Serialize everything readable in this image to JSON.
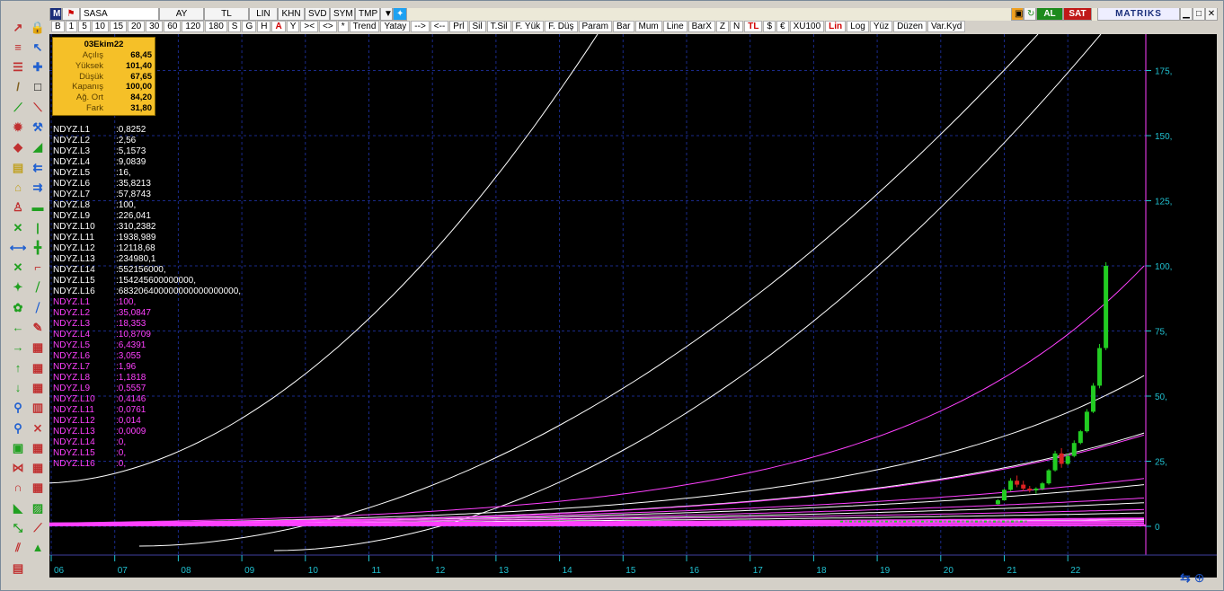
{
  "toolbar_top": {
    "m_label": "M",
    "symbol": "SASA",
    "period": "AY",
    "currency": "TL",
    "scale": "LIN",
    "khn": "KHN",
    "svd": "SVD",
    "sym": "SYM",
    "tmp": "TMP",
    "al": "AL",
    "sat": "SAT",
    "brand": "MATRIKS"
  },
  "toolbar_buttons": [
    "B",
    "1",
    "5",
    "10",
    "15",
    "20",
    "30",
    "60",
    "120",
    "180",
    "S",
    "G",
    "H",
    "A",
    "Y",
    "><",
    "<>",
    "*",
    "Trend",
    "Yatay",
    "-->",
    "<--",
    "Prl",
    "Sil",
    "T.Sil",
    "F. Yük",
    "F. Düş",
    "Param",
    "Bar",
    "Mum",
    "Line",
    "BarX",
    "Z",
    "N",
    "TL",
    "$",
    "€",
    "XU100",
    "Lin",
    "Log",
    "Yüz",
    "Düzen",
    "Var.Kyd"
  ],
  "info_box": {
    "date": "03Ekim22",
    "rows": [
      {
        "k": "Açılış",
        "v": "68,45"
      },
      {
        "k": "Yüksek",
        "v": "101,40"
      },
      {
        "k": "Düşük",
        "v": "67,65"
      },
      {
        "k": "Kapanış",
        "v": "100,00"
      },
      {
        "k": "Ağ. Ort",
        "v": "84,20"
      },
      {
        "k": "Fark",
        "v": "31,80"
      }
    ]
  },
  "levels_white": [
    {
      "n": "NDYZ.L1",
      "v": ":0,8252"
    },
    {
      "n": "NDYZ.L2",
      "v": ":2,56"
    },
    {
      "n": "NDYZ.L3",
      "v": ":5,1573"
    },
    {
      "n": "NDYZ.L4",
      "v": ":9,0839"
    },
    {
      "n": "NDYZ.L5",
      "v": ":16,"
    },
    {
      "n": "NDYZ.L6",
      "v": ":35,8213"
    },
    {
      "n": "NDYZ.L7",
      "v": ":57,8743"
    },
    {
      "n": "NDYZ.L8",
      "v": ":100,"
    },
    {
      "n": "NDYZ.L9",
      "v": ":226,041"
    },
    {
      "n": "NDYZ.L10",
      "v": ":310,2382"
    },
    {
      "n": "NDYZ.L11",
      "v": ":1938,989"
    },
    {
      "n": "NDYZ.L12",
      "v": ":12118,68"
    },
    {
      "n": "NDYZ.L13",
      "v": ":234980,1"
    },
    {
      "n": "NDYZ.L14",
      "v": ":552156000,"
    },
    {
      "n": "NDYZ.L15",
      "v": ":154245600000000,"
    },
    {
      "n": "NDYZ.L16",
      "v": ":683206400000000000000000,"
    }
  ],
  "levels_magenta": [
    {
      "n": "NDYZ.L1",
      "v": ":100,"
    },
    {
      "n": "NDYZ.L2",
      "v": ":35,0847"
    },
    {
      "n": "NDYZ.L3",
      "v": ":18,353"
    },
    {
      "n": "NDYZ.L4",
      "v": ":10,8709"
    },
    {
      "n": "NDYZ.L5",
      "v": ":6,4391"
    },
    {
      "n": "NDYZ.L6",
      "v": ":3,055"
    },
    {
      "n": "NDYZ.L7",
      "v": ":1,96"
    },
    {
      "n": "NDYZ.L8",
      "v": ":1,1818"
    },
    {
      "n": "NDYZ.L9",
      "v": ":0,5557"
    },
    {
      "n": "NDYZ.L10",
      "v": ":0,4146"
    },
    {
      "n": "NDYZ.L11",
      "v": ":0,0761"
    },
    {
      "n": "NDYZ.L12",
      "v": ":0,014"
    },
    {
      "n": "NDYZ.L13",
      "v": ":0,0009"
    },
    {
      "n": "NDYZ.L14",
      "v": ":0,"
    },
    {
      "n": "NDYZ.L15",
      "v": ":0,"
    },
    {
      "n": "NDYZ.L16",
      "v": ":0,"
    }
  ],
  "colors": {
    "background": "#000000",
    "axis_text": "#20c0d0",
    "white_levels": "#ffffff",
    "magenta_levels": "#ff40ff",
    "up_candle": "#22cc22",
    "down_candle": "#dd2222",
    "info_box": "#f5c028"
  },
  "chart_data": {
    "type": "candlestick",
    "y_ticks": [
      "175,",
      "150,",
      "125,",
      "100,",
      "75,",
      "50,",
      "25,",
      "0"
    ],
    "x_ticks": [
      "06",
      "07",
      "08",
      "09",
      "10",
      "11",
      "12",
      "13",
      "14",
      "15",
      "16",
      "17",
      "18",
      "19",
      "20",
      "21",
      "22"
    ],
    "ylim": [
      0,
      185
    ],
    "grid": true,
    "candles": [
      {
        "x": "20.9",
        "o": 8.5,
        "h": 10.5,
        "l": 8.2,
        "c": 10.0
      },
      {
        "x": "21.0",
        "o": 10.0,
        "h": 14.5,
        "l": 9.8,
        "c": 14.0
      },
      {
        "x": "21.1",
        "o": 14.0,
        "h": 18.5,
        "l": 13.5,
        "c": 17.5
      },
      {
        "x": "21.2",
        "o": 17.5,
        "h": 19.5,
        "l": 15.0,
        "c": 16.0
      },
      {
        "x": "21.3",
        "o": 16.0,
        "h": 17.5,
        "l": 13.5,
        "c": 14.5
      },
      {
        "x": "21.4",
        "o": 14.5,
        "h": 15.5,
        "l": 13.0,
        "c": 13.8
      },
      {
        "x": "21.5",
        "o": 13.8,
        "h": 15.0,
        "l": 12.5,
        "c": 14.5
      },
      {
        "x": "21.6",
        "o": 14.5,
        "h": 17.0,
        "l": 13.8,
        "c": 16.5
      },
      {
        "x": "21.7",
        "o": 16.5,
        "h": 22.0,
        "l": 16.0,
        "c": 21.5
      },
      {
        "x": "21.8",
        "o": 21.5,
        "h": 29.0,
        "l": 21.0,
        "c": 28.0
      },
      {
        "x": "21.9",
        "o": 28.0,
        "h": 30.0,
        "l": 22.5,
        "c": 24.0
      },
      {
        "x": "22.0",
        "o": 24.0,
        "h": 28.0,
        "l": 23.5,
        "c": 27.0
      },
      {
        "x": "22.1",
        "o": 27.0,
        "h": 33.0,
        "l": 26.5,
        "c": 32.0
      },
      {
        "x": "22.2",
        "o": 32.0,
        "h": 37.0,
        "l": 31.5,
        "c": 36.5
      },
      {
        "x": "22.3",
        "o": 36.5,
        "h": 45.0,
        "l": 36.0,
        "c": 44.0
      },
      {
        "x": "22.4",
        "o": 44.0,
        "h": 55.0,
        "l": 43.5,
        "c": 54.0
      },
      {
        "x": "22.5",
        "o": 54.0,
        "h": 70.0,
        "l": 53.0,
        "c": 68.45
      },
      {
        "x": "22.6",
        "o": 68.45,
        "h": 101.4,
        "l": 67.65,
        "c": 100.0
      }
    ]
  }
}
